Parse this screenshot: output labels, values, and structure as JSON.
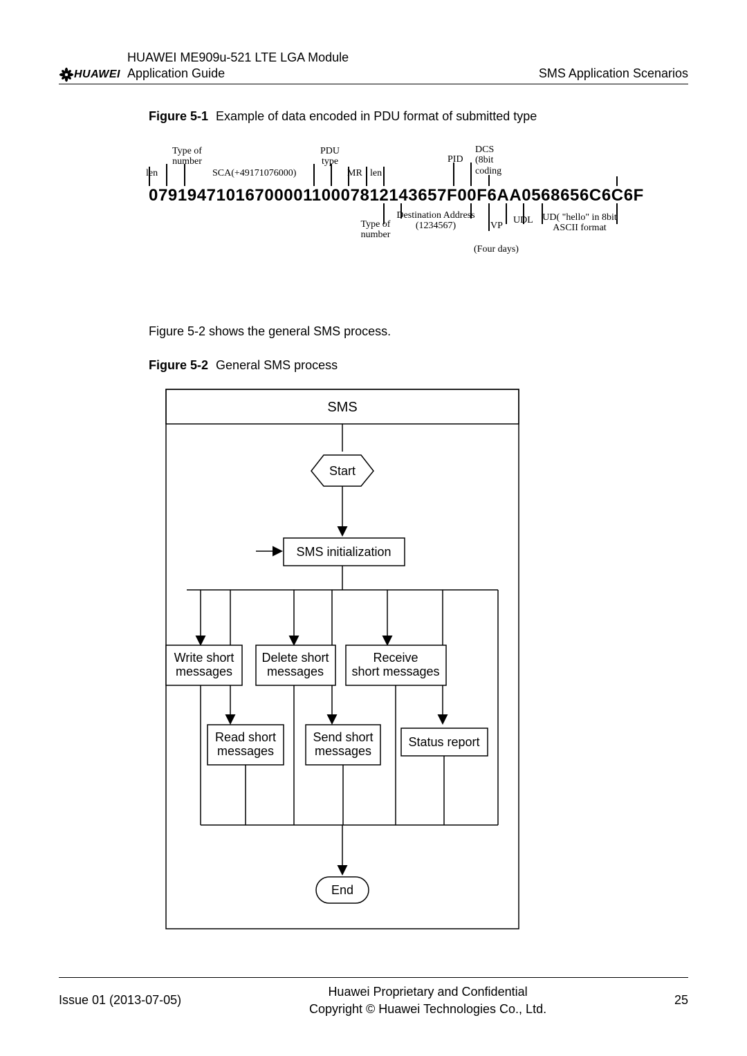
{
  "header": {
    "logo_text": "HUAWEI",
    "title_line1": "HUAWEI ME909u-521 LTE LGA Module",
    "title_line2": "Application Guide",
    "right": "SMS Application Scenarios"
  },
  "figure1": {
    "caption_bold": "Figure 5-1",
    "caption_rest": "Example of data encoded in PDU format of submitted type",
    "hex": "0791947101670000110007812143657F00F6AA0568656C6C6F",
    "labels": {
      "len": "len",
      "type_of_number": "Type of\nnumber",
      "sca": "SCA(+49171076000)",
      "pdu_type": "PDU\ntype",
      "mr": "MR",
      "len2": "len",
      "type_of_number2": "Type of\nnumber",
      "dest_addr": "Destination Address\n(1234567)",
      "pid": "PID",
      "dcs": "DCS\n(8bit\ncoding",
      "vp": "VP",
      "four_days": "(Four days)",
      "udl": "UDL",
      "ud": "UD( \"hello\" in 8bit\nASCII format"
    }
  },
  "intro_text": "Figure 5-2 shows the general SMS process.",
  "figure2": {
    "caption_bold": "Figure 5-2",
    "caption_rest": "General SMS process",
    "nodes": {
      "title": "SMS",
      "start": "Start",
      "init": "SMS initialization",
      "write": "Write short\nmessages",
      "delete_": "Delete short\nmessages",
      "receive": "Receive\nshort messages",
      "read": "Read short\nmessages",
      "send": "Send short\nmessages",
      "status": "Status report",
      "end": "End"
    }
  },
  "chart_data": {
    "type": "flowchart",
    "title": "SMS",
    "nodes": [
      {
        "id": "start",
        "label": "Start",
        "shape": "hexagon-ish"
      },
      {
        "id": "init",
        "label": "SMS initialization",
        "shape": "rect"
      },
      {
        "id": "write",
        "label": "Write short messages",
        "shape": "rect"
      },
      {
        "id": "delete",
        "label": "Delete short messages",
        "shape": "rect"
      },
      {
        "id": "receive",
        "label": "Receive short messages",
        "shape": "rect"
      },
      {
        "id": "read",
        "label": "Read short messages",
        "shape": "rect"
      },
      {
        "id": "send",
        "label": "Send short messages",
        "shape": "rect"
      },
      {
        "id": "status",
        "label": "Status report",
        "shape": "rect"
      },
      {
        "id": "end",
        "label": "End",
        "shape": "rounded-rect"
      }
    ],
    "edges": [
      [
        "start",
        "init"
      ],
      [
        "init",
        "write"
      ],
      [
        "init",
        "delete"
      ],
      [
        "init",
        "receive"
      ],
      [
        "write",
        "read"
      ],
      [
        "write",
        "send"
      ],
      [
        "delete",
        "status"
      ],
      [
        "receive",
        "status"
      ],
      [
        "read",
        "end"
      ],
      [
        "send",
        "end"
      ],
      [
        "status",
        "end"
      ],
      [
        "end",
        "init"
      ]
    ]
  },
  "footer": {
    "left": "Issue 01 (2013-07-05)",
    "center_line1": "Huawei Proprietary and Confidential",
    "center_line2": "Copyright © Huawei Technologies Co., Ltd.",
    "right": "25"
  }
}
